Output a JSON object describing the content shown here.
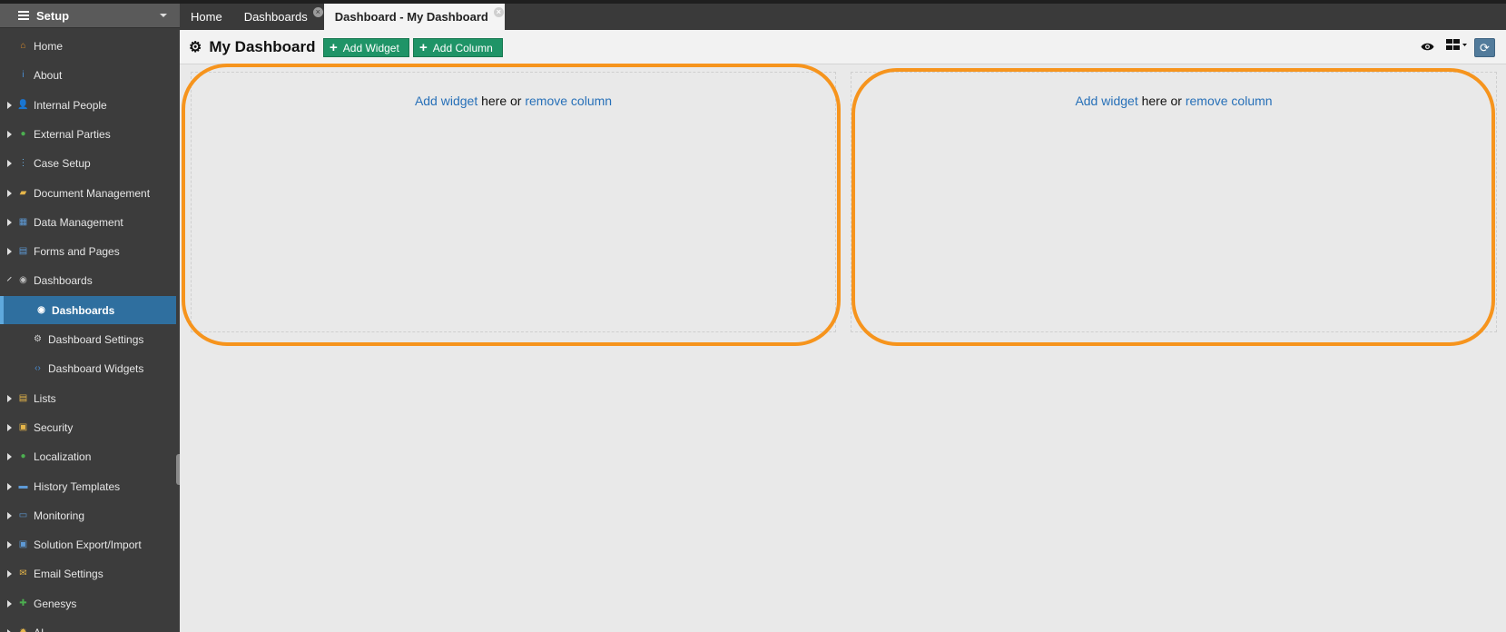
{
  "sidebar": {
    "header": "Setup",
    "items": [
      {
        "label": "Home",
        "icon": "house-icon",
        "color": "#d98b2b",
        "expandable": false,
        "child": false
      },
      {
        "label": "About",
        "icon": "info-icon",
        "color": "#4a8fd6",
        "expandable": false,
        "child": false
      },
      {
        "label": "Internal People",
        "icon": "people-icon",
        "color": "#e5a13a",
        "expandable": true,
        "child": false
      },
      {
        "label": "External Parties",
        "icon": "globe-icon",
        "color": "#4caf50",
        "expandable": true,
        "child": false
      },
      {
        "label": "Case Setup",
        "icon": "tree-icon",
        "color": "#6fb2e6",
        "expandable": true,
        "child": false
      },
      {
        "label": "Document Management",
        "icon": "folder-icon",
        "color": "#e6b64a",
        "expandable": true,
        "child": false
      },
      {
        "label": "Data Management",
        "icon": "table-icon",
        "color": "#5e9ad6",
        "expandable": true,
        "child": false
      },
      {
        "label": "Forms and Pages",
        "icon": "form-icon",
        "color": "#5e9ad6",
        "expandable": true,
        "child": false
      },
      {
        "label": "Dashboards",
        "icon": "gauge-icon",
        "color": "#bfbfbf",
        "expandable": true,
        "open": true,
        "child": false
      },
      {
        "label": "Dashboards",
        "icon": "gauge-icon",
        "color": "#ffffff",
        "expandable": false,
        "child": true,
        "active": true
      },
      {
        "label": "Dashboard Settings",
        "icon": "gear-icon",
        "color": "#d0d0d0",
        "expandable": false,
        "child": true
      },
      {
        "label": "Dashboard Widgets",
        "icon": "code-icon",
        "color": "#4a8fd6",
        "expandable": false,
        "child": true
      },
      {
        "label": "Lists",
        "icon": "list-icon",
        "color": "#e6b64a",
        "expandable": true,
        "child": false
      },
      {
        "label": "Security",
        "icon": "lock-icon",
        "color": "#e6b64a",
        "expandable": true,
        "child": false
      },
      {
        "label": "Localization",
        "icon": "globe-icon",
        "color": "#4caf50",
        "expandable": true,
        "child": false
      },
      {
        "label": "History Templates",
        "icon": "template-icon",
        "color": "#5e9ad6",
        "expandable": true,
        "child": false
      },
      {
        "label": "Monitoring",
        "icon": "monitor-icon",
        "color": "#5e9ad6",
        "expandable": true,
        "child": false
      },
      {
        "label": "Solution Export/Import",
        "icon": "save-icon",
        "color": "#5e9ad6",
        "expandable": true,
        "child": false
      },
      {
        "label": "Email Settings",
        "icon": "email-icon",
        "color": "#e6b64a",
        "expandable": true,
        "child": false
      },
      {
        "label": "Genesys",
        "icon": "puzzle-icon",
        "color": "#4caf50",
        "expandable": true,
        "child": false
      },
      {
        "label": "AI",
        "icon": "sun-icon",
        "color": "#e6b64a",
        "expandable": true,
        "child": false
      }
    ]
  },
  "tabs": [
    {
      "label": "Home",
      "closable": false,
      "active": false
    },
    {
      "label": "Dashboards",
      "closable": true,
      "active": false
    },
    {
      "label": "Dashboard - My Dashboard",
      "closable": true,
      "active": true
    }
  ],
  "toolbar": {
    "title": "My Dashboard",
    "add_widget": "Add Widget",
    "add_column": "Add Column"
  },
  "columns": [
    {
      "add_widget": "Add widget",
      "middle": "here or",
      "remove_column": "remove column"
    },
    {
      "add_widget": "Add widget",
      "middle": "here or",
      "remove_column": "remove column"
    }
  ],
  "colors": {
    "highlight": "#f6941d",
    "button": "#1f9467",
    "link": "#2770b8",
    "active_nav": "#2f6f9f"
  }
}
